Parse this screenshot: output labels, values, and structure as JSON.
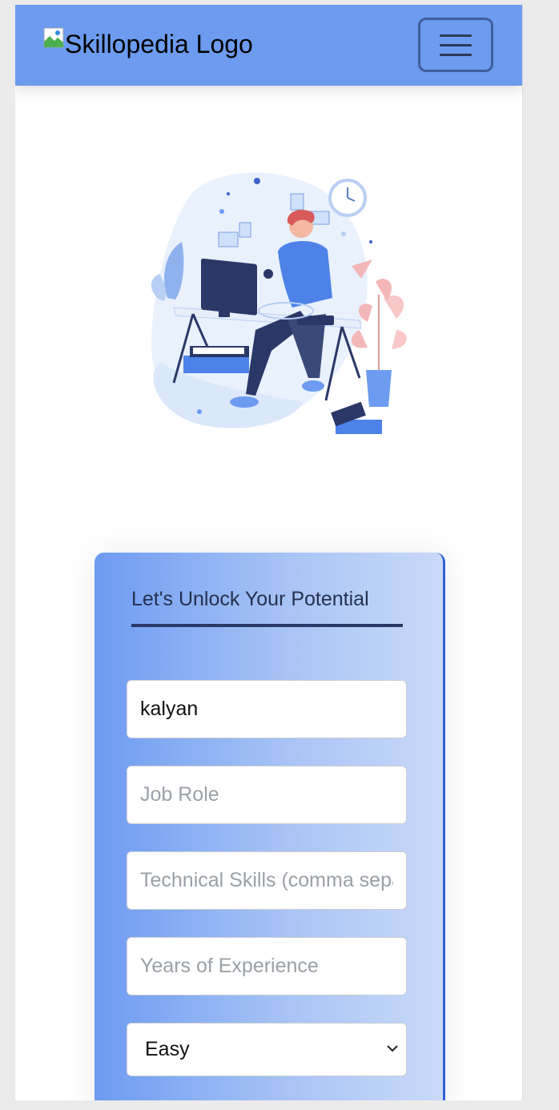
{
  "navbar": {
    "logo_alt": "Skillopedia Logo",
    "menu_icon": "hamburger-menu-icon"
  },
  "hero": {
    "illustration": "person-working-at-desk-illustration"
  },
  "form": {
    "title": "Let's Unlock Your Potential",
    "name_value": "kalyan",
    "job_role_placeholder": "Job Role",
    "skills_placeholder": "Technical Skills (comma separated)",
    "experience_placeholder": "Years of Experience",
    "difficulty_selected": "Easy"
  },
  "colors": {
    "navbar": "#6c9bf0",
    "accent": "#2f63d6",
    "title_underline": "#2a3868"
  }
}
